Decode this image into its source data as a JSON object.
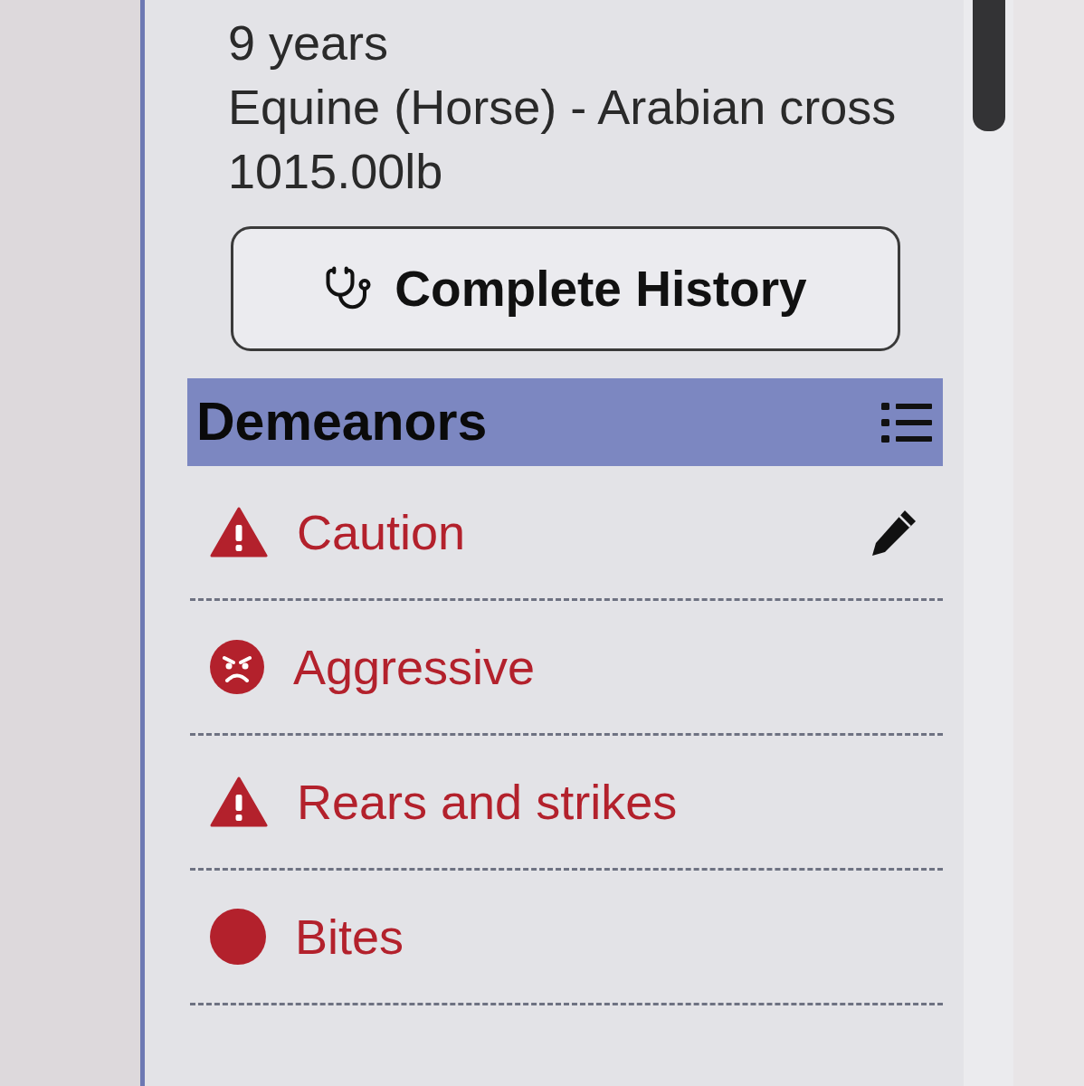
{
  "details": [
    "9 years",
    "Equine (Horse) - Arabian cross",
    "1015.00lb"
  ],
  "history_button": {
    "label": "Complete History"
  },
  "section": {
    "title": "Demeanors"
  },
  "demeanors": [
    {
      "label": "Caution",
      "kind": "warning",
      "editable": true
    },
    {
      "label": "Aggressive",
      "kind": "angry",
      "editable": false
    },
    {
      "label": "Rears and strikes",
      "kind": "warning",
      "editable": false
    },
    {
      "label": "Bites",
      "kind": "dot",
      "editable": false
    }
  ]
}
